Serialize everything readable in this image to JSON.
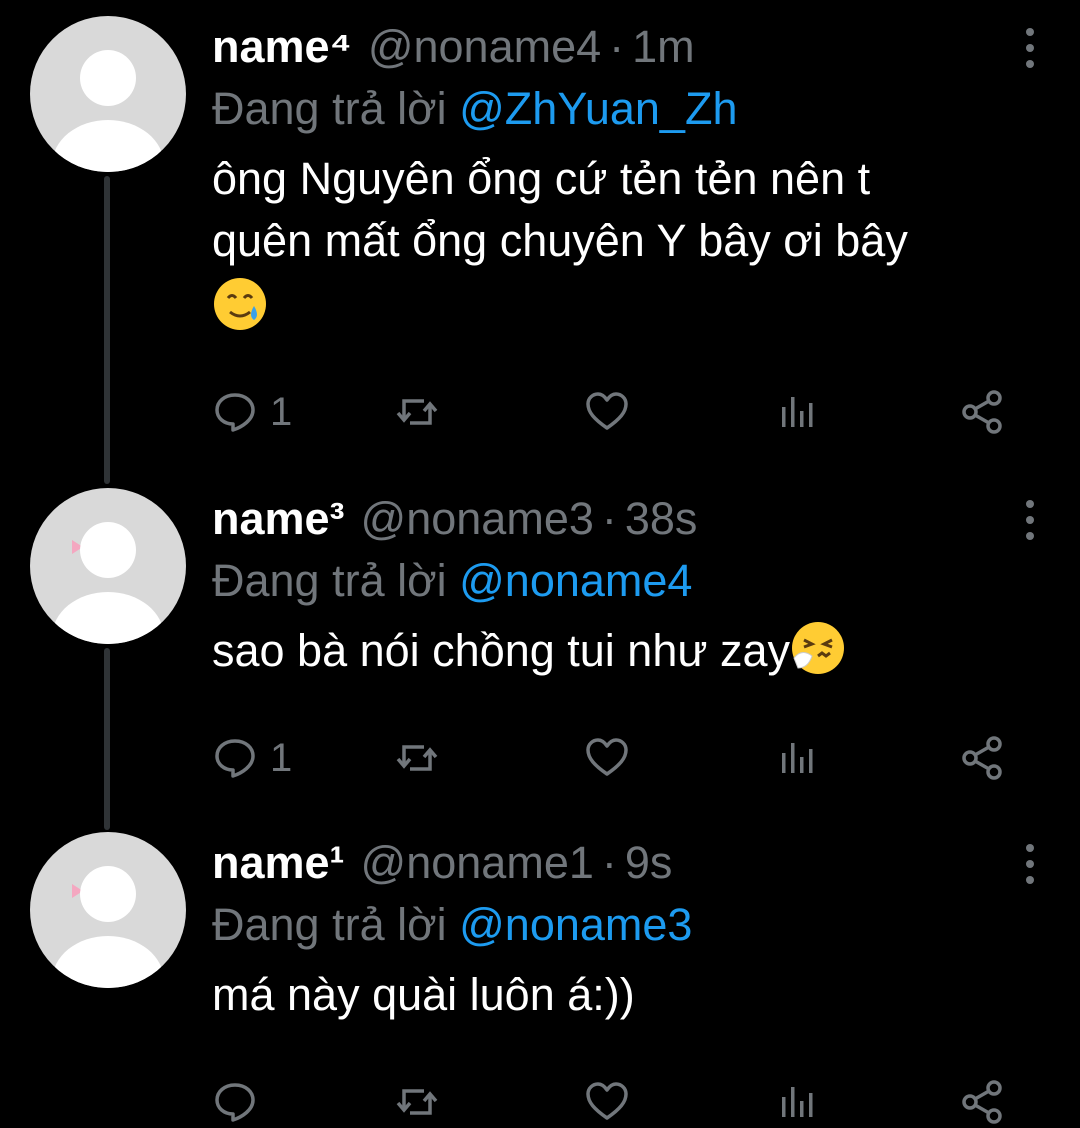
{
  "tweets": [
    {
      "name": "name⁴",
      "handle": "@noname4",
      "separator": "·",
      "time": "1m",
      "reply_prefix": "Đang trả lời",
      "reply_to": "@ZhYuan_Zh",
      "text_line1": "ông Nguyên ổng cứ tẻn tẻn nên t",
      "text_line2": "quên mất ổng chuyên Y bây ơi bây",
      "emoji": "smiling-face-with-tear",
      "reply_count": "1",
      "avatar_bow": false
    },
    {
      "name": "name³",
      "handle": "@noname3",
      "separator": "·",
      "time": "38s",
      "reply_prefix": "Đang trả lời",
      "reply_to": "@noname4",
      "text_line1": "sao bà nói chồng tui như zay",
      "emoji": "sneezing-face",
      "reply_count": "1",
      "avatar_bow": true
    },
    {
      "name": "name¹",
      "handle": "@noname1",
      "separator": "·",
      "time": "9s",
      "reply_prefix": "Đang trả lời",
      "reply_to": "@noname3",
      "text_line1": "má này quài luôn á:))",
      "reply_count": "",
      "avatar_bow": true
    }
  ],
  "colors": {
    "background": "#000000",
    "text": "#ffffff",
    "muted": "#71767b",
    "link": "#1d9bf0",
    "thread_line": "#2f3336"
  },
  "icons": [
    "comment-icon",
    "retweet-icon",
    "like-icon",
    "views-icon",
    "share-icon",
    "more-icon"
  ]
}
